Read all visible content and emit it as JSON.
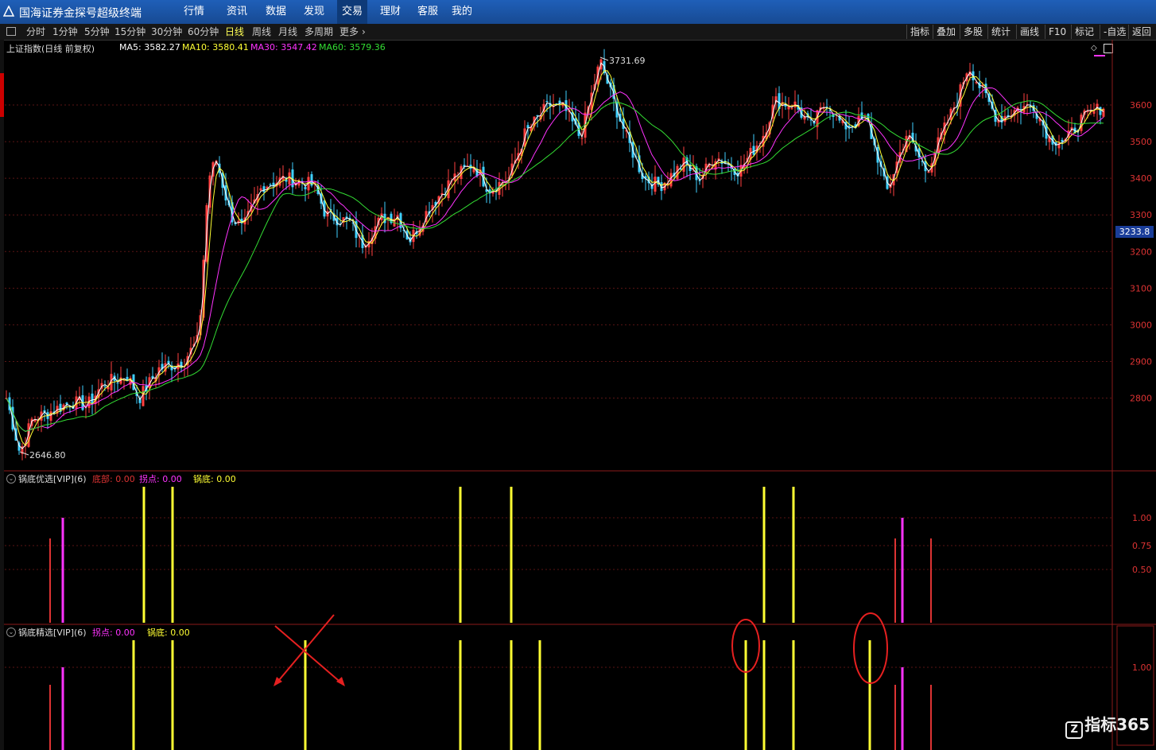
{
  "app": {
    "title": "国海证券金探号超级终端"
  },
  "menu": [
    "行情",
    "资讯",
    "数据",
    "发现",
    "交易",
    "理财",
    "客服",
    "我的"
  ],
  "menu_active": "交易",
  "periods": [
    "分时",
    "1分钟",
    "5分钟",
    "15分钟",
    "30分钟",
    "60分钟",
    "日线",
    "周线",
    "月线",
    "多周期",
    "更多"
  ],
  "period_selected": "日线",
  "right_tools": [
    "指标",
    "叠加",
    "多股",
    "统计",
    "画线",
    "F10",
    "标记",
    "-自选",
    "返回"
  ],
  "main": {
    "name": "上证指数(日线 前复权)",
    "ma": [
      {
        "label": "MA5: 3582.27",
        "color": "#ffffff"
      },
      {
        "label": "MA10: 3580.41",
        "color": "#ffff33"
      },
      {
        "label": "MA30: 3547.42",
        "color": "#ff33ff"
      },
      {
        "label": "MA60: 3579.36",
        "color": "#33dd33"
      }
    ],
    "high_label": "3731.69",
    "low_label": "2646.80",
    "current_price": "3233.8",
    "axis": [
      "3600",
      "3500",
      "3400",
      "3300",
      "3200",
      "3100",
      "3000",
      "2900",
      "2800"
    ]
  },
  "ind1": {
    "title": "锅底优选[VIP](6)",
    "items": [
      {
        "label": "底部: 0.00",
        "color": "#dd3333"
      },
      {
        "label": "拐点: 0.00",
        "color": "#ff33ff"
      },
      {
        "label": "锅底: 0.00",
        "color": "#ffff33"
      }
    ],
    "axis": [
      "1.00",
      "0.75",
      "0.50"
    ]
  },
  "ind2": {
    "title": "锅底精选[VIP](6)",
    "items": [
      {
        "label": "拐点: 0.00",
        "color": "#ff33ff"
      },
      {
        "label": "锅底: 0.00",
        "color": "#ffff33"
      }
    ],
    "axis": [
      "1.00"
    ]
  },
  "watermark": "指标365"
}
